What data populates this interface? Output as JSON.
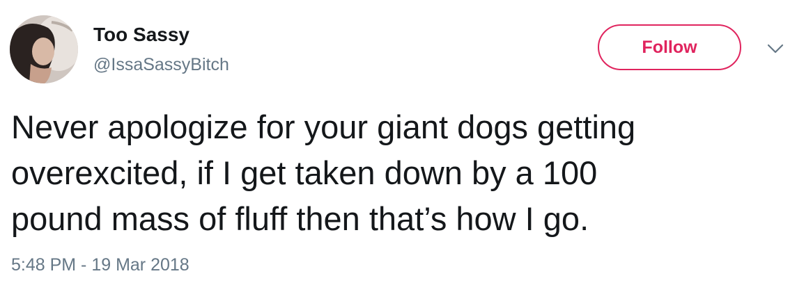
{
  "user": {
    "display_name": "Too Sassy",
    "handle": "@IssaSassyBitch"
  },
  "actions": {
    "follow_label": "Follow"
  },
  "tweet": {
    "lines": [
      "Never apologize for your giant dogs getting",
      "overexcited, if I get taken down by a 100",
      "pound mass of fluff then that’s how I go."
    ],
    "timestamp": "5:48 PM - 19 Mar 2018"
  },
  "icons": {
    "menu": "chevron-down-icon"
  },
  "colors": {
    "follow_accent": "#e0245e",
    "secondary_text": "#657786",
    "primary_text": "#14171a"
  }
}
